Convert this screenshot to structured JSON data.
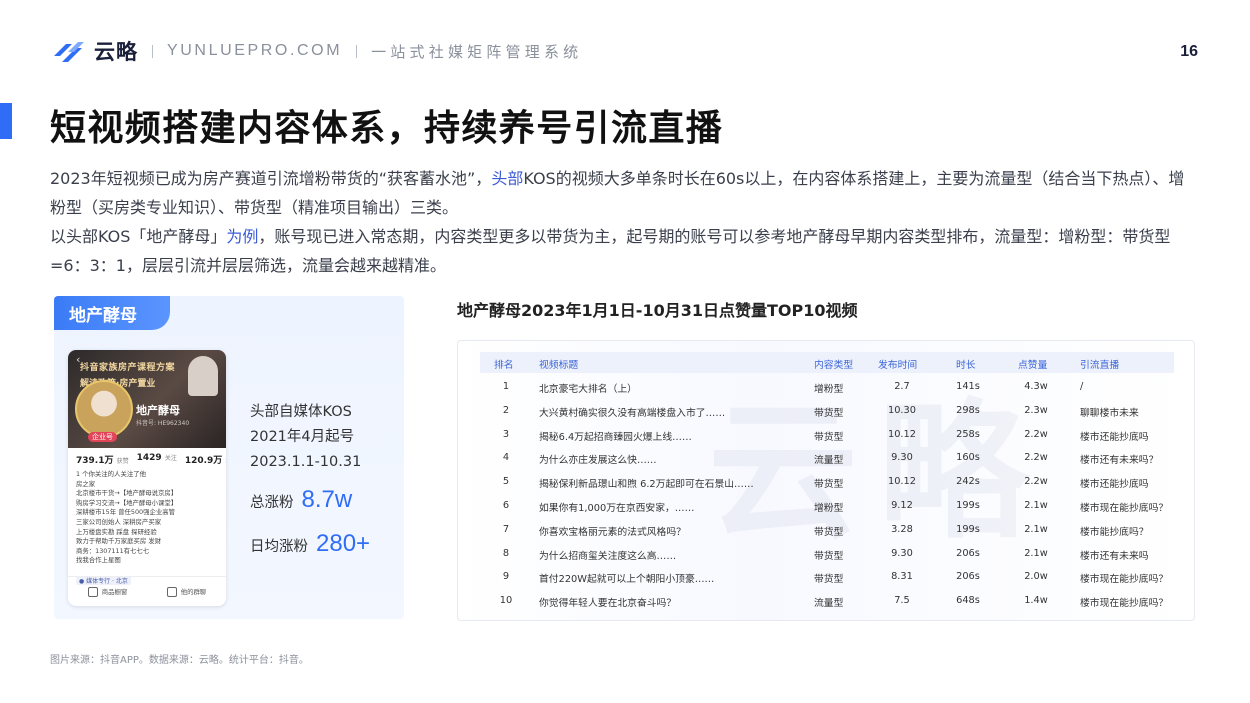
{
  "header": {
    "brand": "云略",
    "site": "YUNLUEPRO.COM",
    "slogan": "一站式社媒矩阵管理系统",
    "page_number": "16"
  },
  "title": "短视频搭建内容体系，持续养号引流直播",
  "intro": {
    "p1_a": "2023年短视频已成为房产赛道引流增粉带货的“获客蓄水池”，",
    "p1_hl": "头部",
    "p1_b": "KOS的视频大多单条时长在60s以上，在内容体系搭建上，主要为流量型（结合当下热点）、增粉型（买房类专业知识）、带货型（精准项目输出）三类。",
    "p2_a": "以头部KOS「地产酵母」",
    "p2_hl": "为例",
    "p2_b": "，账号现已进入常态期，内容类型更多以带货为主，起号期的账号可以参考地产酵母早期内容类型排布，流量型：增粉型：带货型=6：3：1，层层引流并层层筛选，流量会越来越精准。"
  },
  "card": {
    "tag": "地产酵母",
    "info_lines": [
      "头部自媒体KOS",
      "2021年4月起号",
      "2023.1.1-10.31"
    ],
    "total_fans_label": "总涨粉",
    "total_fans_value": "8.7w",
    "daily_fans_label": "日均涨粉",
    "daily_fans_value": "280+",
    "phone": {
      "banner1": "抖音家族房产课程方案",
      "banner2": "解读政策·房产置业",
      "name": "地产酵母",
      "id": "抖音号: HE962340",
      "badge": "企业号",
      "stats": [
        {
          "num": "739.1万",
          "label": "获赞"
        },
        {
          "num": "1429",
          "label": "关注"
        },
        {
          "num": "120.9万",
          "label": "粉丝"
        }
      ],
      "lines": [
        "1 个你关注的人关注了他",
        "房之家",
        "北京楼市干货→【地产酵母说京房】",
        "购房学习交流→【地产酵母小课堂】",
        "深耕楼市15年 曾任500强企业高管",
        "三家公司创始人 深耕房产买家",
        "上万楼盘实勘 踩盘 探研经验",
        "致力于帮助千万家庭买房 发财",
        "商务：1307111有七七七",
        "找我合作上星图"
      ],
      "chip": "● 媒体专行 · 北京",
      "bottom_left": "商品橱窗",
      "bottom_right": "他的群聊"
    }
  },
  "table": {
    "title": "地产酵母2023年1月1日-10月31日点赞量TOP10视频",
    "watermark": "云略",
    "headers": [
      "排名",
      "视频标题",
      "内容类型",
      "发布时间",
      "时长",
      "点赞量",
      "引流直播"
    ],
    "rows": [
      [
        "1",
        "北京豪宅大排名（上）",
        "增粉型",
        "2.7",
        "141s",
        "4.3w",
        "/"
      ],
      [
        "2",
        "大兴黄村确实很久没有高端楼盘入市了……",
        "带货型",
        "10.30",
        "298s",
        "2.3w",
        "聊聊楼市未来"
      ],
      [
        "3",
        "揭秘6.4万起招商臻园火爆上线……",
        "带货型",
        "10.12",
        "258s",
        "2.2w",
        "楼市还能抄底吗"
      ],
      [
        "4",
        "为什么亦庄发展这么快……",
        "流量型",
        "9.30",
        "160s",
        "2.2w",
        "楼市还有未来吗？"
      ],
      [
        "5",
        "揭秘保利新品璟山和煦 6.2万起即可在石景山……",
        "带货型",
        "10.12",
        "242s",
        "2.2w",
        "楼市还能抄底吗"
      ],
      [
        "6",
        "如果你有1,000万在京西安家，……",
        "增粉型",
        "9.12",
        "199s",
        "2.1w",
        "楼市现在能抄底吗？"
      ],
      [
        "7",
        "你喜欢宝格丽元素的法式风格吗？",
        "带货型",
        "3.28",
        "199s",
        "2.1w",
        "楼市能抄底吗？"
      ],
      [
        "8",
        "为什么招商玺关注度这么高……",
        "带货型",
        "9.30",
        "206s",
        "2.1w",
        "楼市还有未来吗"
      ],
      [
        "9",
        "首付220W起就可以上个朝阳小顶豪……",
        "带货型",
        "8.31",
        "206s",
        "2.0w",
        "楼市现在能抄底吗？"
      ],
      [
        "10",
        "你觉得年轻人要在北京奋斗吗？",
        "流量型",
        "7.5",
        "648s",
        "1.4w",
        "楼市现在能抄底吗？"
      ]
    ]
  },
  "footer": "图片来源：抖音APP。数据来源：云略。统计平台：抖音。",
  "colors": {
    "accent": "#2f6df6",
    "header_text": "#3a64d8"
  }
}
